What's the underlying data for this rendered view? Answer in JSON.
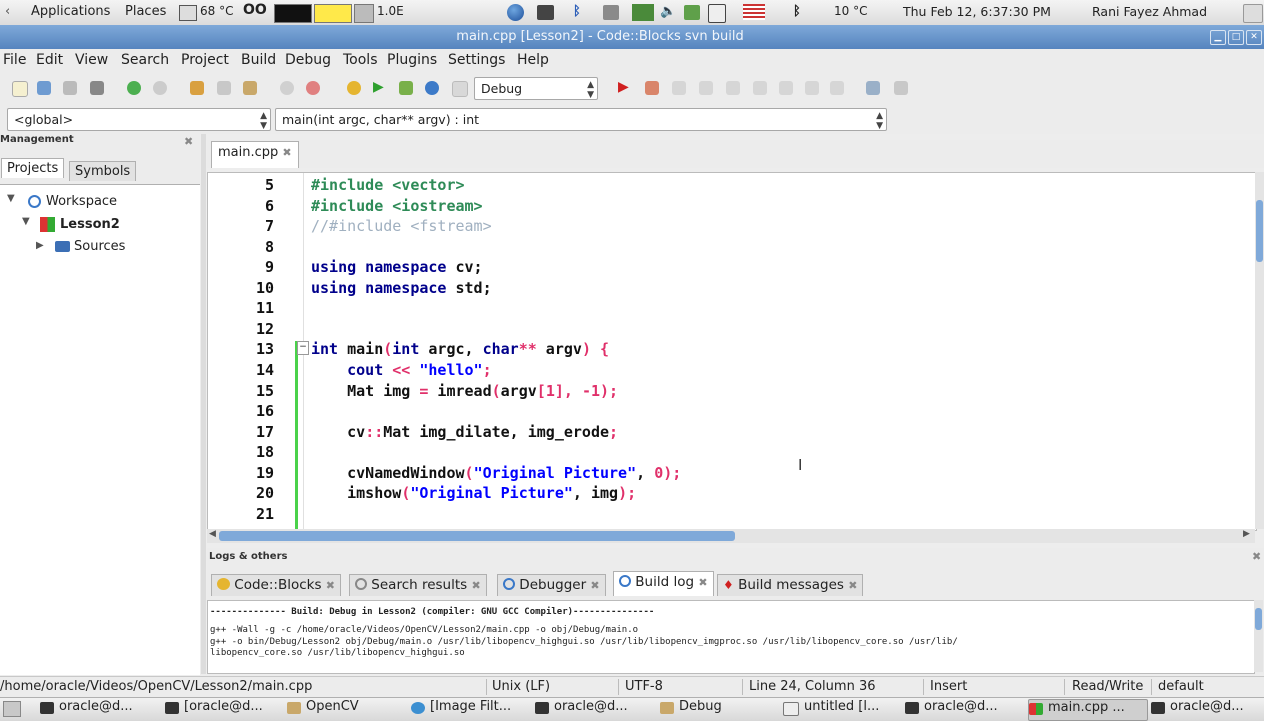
{
  "system_panel": {
    "applications": "Applications",
    "places": "Places",
    "weather_left": "68 °C",
    "volume": "1.0E",
    "weather_right": "10 °C",
    "datetime": "Thu Feb 12,  6:37:30 PM",
    "user": "Rani Fayez Ahmad"
  },
  "window": {
    "title": "main.cpp [Lesson2] - Code::Blocks svn build"
  },
  "menu": [
    "File",
    "Edit",
    "View",
    "Search",
    "Project",
    "Build",
    "Debug",
    "Tools",
    "Plugins",
    "Settings",
    "Help"
  ],
  "toolbar": {
    "build_target": "Debug"
  },
  "codecompletion": {
    "scope": "<global>",
    "function": "main(int argc, char** argv) : int"
  },
  "management": {
    "header": "Management",
    "tabs": [
      "Projects",
      "Symbols"
    ],
    "tree": {
      "workspace": "Workspace",
      "project": "Lesson2",
      "folder": "Sources"
    }
  },
  "editor": {
    "tab": "main.cpp",
    "line_numbers": [
      "5",
      "6",
      "7",
      "8",
      "9",
      "10",
      "11",
      "12",
      "13",
      "14",
      "15",
      "16",
      "17",
      "18",
      "19",
      "20",
      "21"
    ]
  },
  "logs": {
    "header": "Logs & others",
    "tabs": [
      "Code::Blocks",
      "Search results",
      "Debugger",
      "Build log",
      "Build messages"
    ],
    "active_tab": "Build log",
    "lines": [
      "-------------- Build: Debug in Lesson2 (compiler: GNU GCC Compiler)---------------",
      "g++ -Wall -g  -c /home/oracle/Videos/OpenCV/Lesson2/main.cpp -o obj/Debug/main.o",
      "g++  -o bin/Debug/Lesson2 obj/Debug/main.o   /usr/lib/libopencv_highgui.so /usr/lib/libopencv_imgproc.so /usr/lib/libopencv_core.so /usr/lib/",
      "libopencv_core.so /usr/lib/libopencv_highgui.so"
    ]
  },
  "status": {
    "path": "/home/oracle/Videos/OpenCV/Lesson2/main.cpp",
    "eol": "Unix (LF)",
    "encoding": "UTF-8",
    "position": "Line 24, Column 36",
    "mode": "Insert",
    "access": "Read/Write",
    "profile": "default"
  },
  "taskbar": [
    "oracle@d...",
    "[oracle@d...",
    "OpenCV",
    "[Image Filt...",
    "oracle@d...",
    "Debug",
    "untitled [l...",
    "oracle@d...",
    "main.cpp ...",
    "oracle@d..."
  ],
  "colors": {
    "titlebar": "#5e8cc4",
    "keyword": "#00008b",
    "preprocessor": "#2e8b57",
    "string": "#0000ff",
    "number": "#e0306a",
    "change_bar": "#4ad24a"
  }
}
